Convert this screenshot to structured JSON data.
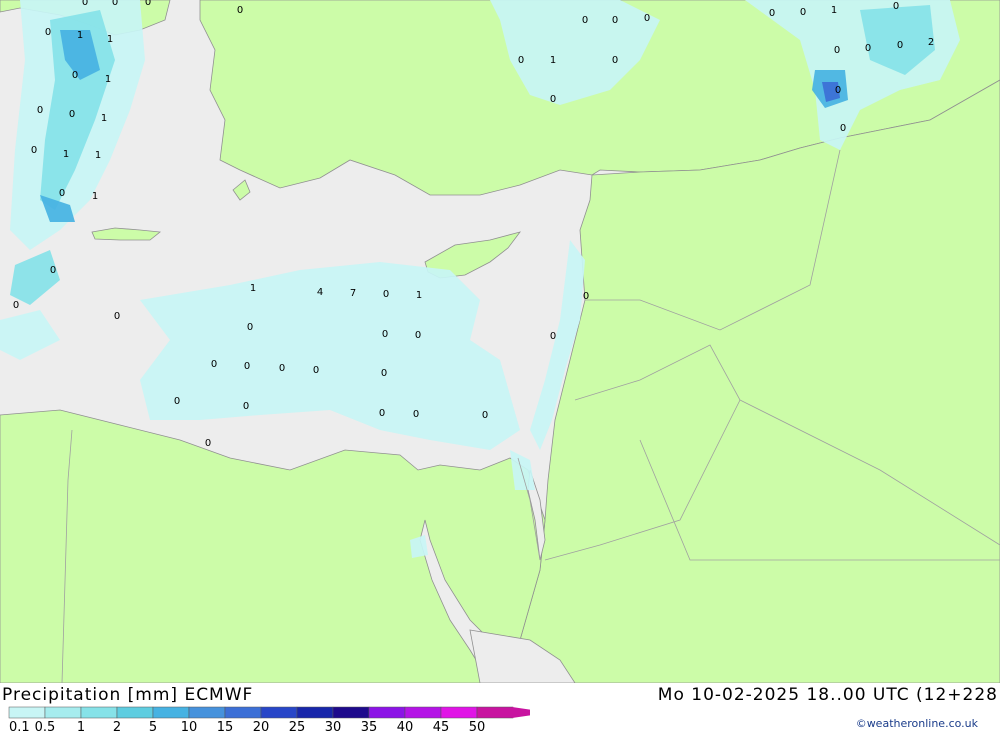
{
  "footer": {
    "title": "Precipitation [mm] ECMWF",
    "datetime": "Mo 10-02-2025 18..00 UTC (12+228",
    "credit": "©weatheronline.co.uk"
  },
  "legend": {
    "labels": [
      "0.1",
      "0.5",
      "1",
      "2",
      "5",
      "10",
      "15",
      "20",
      "25",
      "30",
      "35",
      "40",
      "45",
      "50"
    ],
    "colors": [
      "#c8f5f5",
      "#a6ecee",
      "#86e2e8",
      "#5ecde0",
      "#46b2e2",
      "#4692dc",
      "#3c6fd6",
      "#2846c8",
      "#1826aa",
      "#1e0a8c",
      "#8c14e6",
      "#b414e6",
      "#e014e6",
      "#c814a0"
    ]
  },
  "map": {
    "colors": {
      "land": "#ccfca8",
      "sea": "#ededed",
      "border": "#a0a0a0",
      "coast": "#909090"
    },
    "precip_values": [
      "0",
      "0",
      "0",
      "0",
      "0",
      "0",
      "1",
      "1",
      "0",
      "1",
      "0",
      "0",
      "1",
      "0",
      "1",
      "1",
      "0",
      "1",
      "0",
      "0",
      "1",
      "0",
      "0",
      "0",
      "0",
      "0",
      "0",
      "0",
      "1",
      "0",
      "0",
      "0",
      "0",
      "0",
      "2",
      "0",
      "1",
      "4",
      "7",
      "0",
      "1",
      "0",
      "0",
      "0",
      "0",
      "0",
      "0",
      "0",
      "0",
      "0",
      "0",
      "0",
      "0",
      "0",
      "0",
      "0",
      "0",
      "0",
      "0",
      "0",
      "0",
      "0",
      "0",
      "0"
    ]
  }
}
